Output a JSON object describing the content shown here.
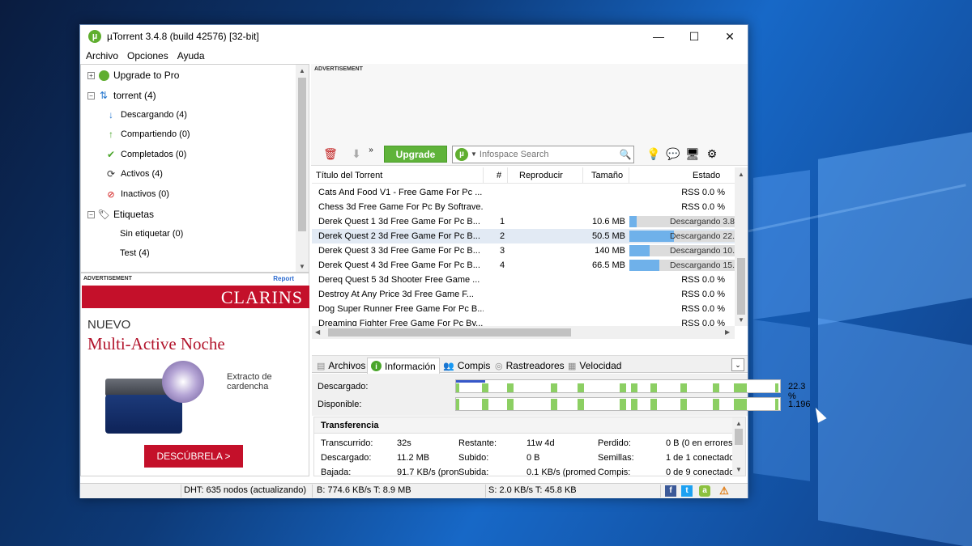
{
  "window": {
    "title": "µTorrent 3.4.8  (build 42576) [32-bit]",
    "controls": {
      "minimize": "—",
      "maximize": "☐",
      "close": "✕"
    }
  },
  "menu": [
    "Archivo",
    "Opciones",
    "Ayuda"
  ],
  "sidebar": {
    "upgrade": "Upgrade to Pro",
    "torrent": "torrent (4)",
    "items": [
      {
        "label": "Descargando (4)",
        "icon": "arrow-down-icon"
      },
      {
        "label": "Compartiendo (0)",
        "icon": "arrow-up-icon"
      },
      {
        "label": "Completados (0)",
        "icon": "check-icon"
      },
      {
        "label": "Activos (4)",
        "icon": "refresh-icon"
      },
      {
        "label": "Inactivos (0)",
        "icon": "inactive-icon"
      }
    ],
    "labels_header": "Etiquetas",
    "labels": [
      "Sin etiquetar (0)",
      "Test (4)"
    ]
  },
  "ad_left": {
    "label": "ADVERTISEMENT",
    "report": "Report",
    "brand": "CLARINS",
    "headline": "NUEVO",
    "product": "Multi-Active Noche",
    "extract": "Extracto de cardencha",
    "cta": "DESCÚBRELA >"
  },
  "ad_top": {
    "label": "ADVERTISEMENT"
  },
  "toolbar": {
    "upgrade": "Upgrade",
    "search_placeholder": "Infospace Search",
    "more": "»"
  },
  "table": {
    "headers": [
      "Título del Torrent",
      "#",
      "Reproducir",
      "Tamaño",
      "Estado"
    ],
    "rows": [
      {
        "name": "Cats And Food V1 -  Free Game For Pc ...",
        "num": "",
        "size": "",
        "status": "RSS 0.0 %",
        "progress": null
      },
      {
        "name": "Chess 3d  Free Game For Pc By Softrave...",
        "num": "",
        "size": "",
        "status": "RSS 0.0 %",
        "progress": null
      },
      {
        "name": "Derek Quest 1 3d    Free Game For Pc B...",
        "num": "1",
        "size": "10.6 MB",
        "status": "Descargando 3.8",
        "progress": 0.038
      },
      {
        "name": "Derek Quest 2 3d    Free Game For Pc B...",
        "num": "2",
        "size": "50.5 MB",
        "status": "Descargando 22.",
        "progress": 0.223
      },
      {
        "name": "Derek Quest 3 3d    Free Game For Pc B...",
        "num": "3",
        "size": "140 MB",
        "status": "Descargando 10.",
        "progress": 0.1
      },
      {
        "name": "Derek Quest 4 3d    Free Game For Pc B...",
        "num": "4",
        "size": "66.5 MB",
        "status": "Descargando 15.",
        "progress": 0.15
      },
      {
        "name": "Dereq Quest 5 3d Shooter   Free Game ...",
        "num": "",
        "size": "",
        "status": "RSS 0.0 %",
        "progress": null
      },
      {
        "name": "Destroy At Any Price 3d     Free Game F...",
        "num": "",
        "size": "",
        "status": "RSS 0.0 %",
        "progress": null
      },
      {
        "name": "Dog Super Runner  Free Game For Pc B...",
        "num": "",
        "size": "",
        "status": "RSS 0.0 %",
        "progress": null
      },
      {
        "name": "Dreaming Fighter  Free Game For Pc By...",
        "num": "",
        "size": "",
        "status": "RSS 0.0 %",
        "progress": null
      }
    ],
    "selected_index": 3
  },
  "tabs": [
    "Archivos",
    "Información",
    "Compis",
    "Rastreadores",
    "Velocidad"
  ],
  "active_tab": 1,
  "info": {
    "downloaded_label": "Descargado:",
    "downloaded_pct": "22.3 %",
    "downloaded_progress": 0.223,
    "available_label": "Disponible:",
    "available_value": "1.196",
    "piece_positions": [
      0.08,
      0.16,
      0.295,
      0.38,
      0.51,
      0.545,
      0.605,
      0.7,
      0.8,
      0.865
    ]
  },
  "transfer": {
    "title": "Transferencia",
    "rows": [
      [
        "Transcurrido:",
        "32s",
        "Restante:",
        "11w 4d",
        "Perdido:",
        "0 B (0 en errores"
      ],
      [
        "Descargado:",
        "11.2 MB",
        "Subido:",
        "0 B",
        "Semillas:",
        "1 de 1 conectado"
      ],
      [
        "Bajada:",
        "91.7 KB/s (pron",
        "Subida:",
        "0.1 KB/s (promed",
        "Compis:",
        "0 de 9 conectado"
      ]
    ]
  },
  "status": {
    "dht": "DHT: 635 nodos  (actualizando)",
    "download": "B: 774.6 KB/s T: 8.9 MB",
    "upload": "S: 2.0 KB/s T: 45.8 KB"
  },
  "colors": {
    "accent_green": "#5fb33a",
    "progress_blue": "#6fb1ea",
    "piece_green": "#8ccf63",
    "brand_red": "#c4102a"
  }
}
